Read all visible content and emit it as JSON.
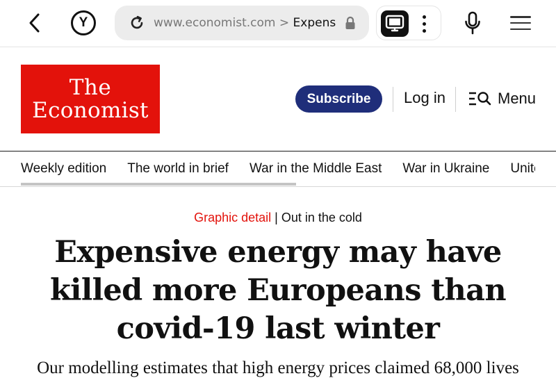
{
  "browser": {
    "url_domain": "www.economist.com",
    "url_separator": " > ",
    "url_path": "Expensive",
    "icons": {
      "back": "chevron-left-icon",
      "yandex": "yandex-icon",
      "reload": "reload-icon",
      "lock": "lock-icon",
      "tabs": "tabs-icon",
      "more": "kebab-icon",
      "mic": "microphone-icon",
      "menu": "hamburger-icon"
    },
    "yandex_glyph": "Y"
  },
  "header": {
    "logo_line1": "The",
    "logo_line2": "Economist",
    "subscribe_label": "Subscribe",
    "login_label": "Log in",
    "menu_label": "Menu",
    "colors": {
      "brand_red": "#e3120b",
      "subscribe_bg": "#1f2e7a"
    }
  },
  "nav": {
    "items": [
      {
        "label": "Weekly edition"
      },
      {
        "label": "The world in brief"
      },
      {
        "label": "War in the Middle East"
      },
      {
        "label": "War in Ukraine"
      },
      {
        "label": "United"
      }
    ]
  },
  "article": {
    "section": "Graphic detail",
    "separator": " | ",
    "rubric": "Out in the cold",
    "headline": "Expensive energy may have killed more Europeans than covid-19 last winter",
    "dek": "Our modelling estimates that high energy prices claimed 68,000 lives"
  }
}
